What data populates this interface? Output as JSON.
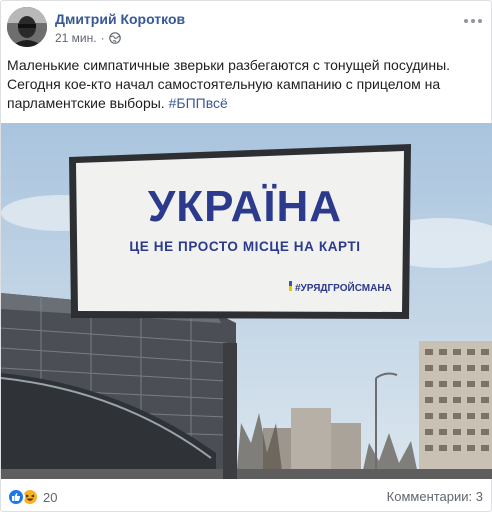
{
  "post": {
    "author": "Дмитрий Коротков",
    "time": "21 мин.",
    "separator": "·",
    "privacy_icon": "globe-icon",
    "more_icon": "more-dots-icon",
    "text_line1": "Маленькие симпатичные зверьки разбегаются с тонущей посудины.",
    "text_line2": "Сегодня кое-кто начал самостоятельную кампанию с прицелом на",
    "text_line3": "парламентские выборы.",
    "hashtag": "#БППвсё"
  },
  "photo": {
    "billboard_title": "УКРАЇНА",
    "billboard_subtitle": "ЦЕ НЕ ПРОСТО МІСЦЕ НА КАРТІ",
    "billboard_hashtag": "#УРЯДГРОЙСМАНА",
    "colors": {
      "title": "#2b3a8c",
      "sky": "#b9cfe3"
    }
  },
  "footer": {
    "reaction_icons": [
      "like-icon",
      "haha-icon"
    ],
    "reaction_count": "20",
    "comments": "Комментарии: 3"
  }
}
